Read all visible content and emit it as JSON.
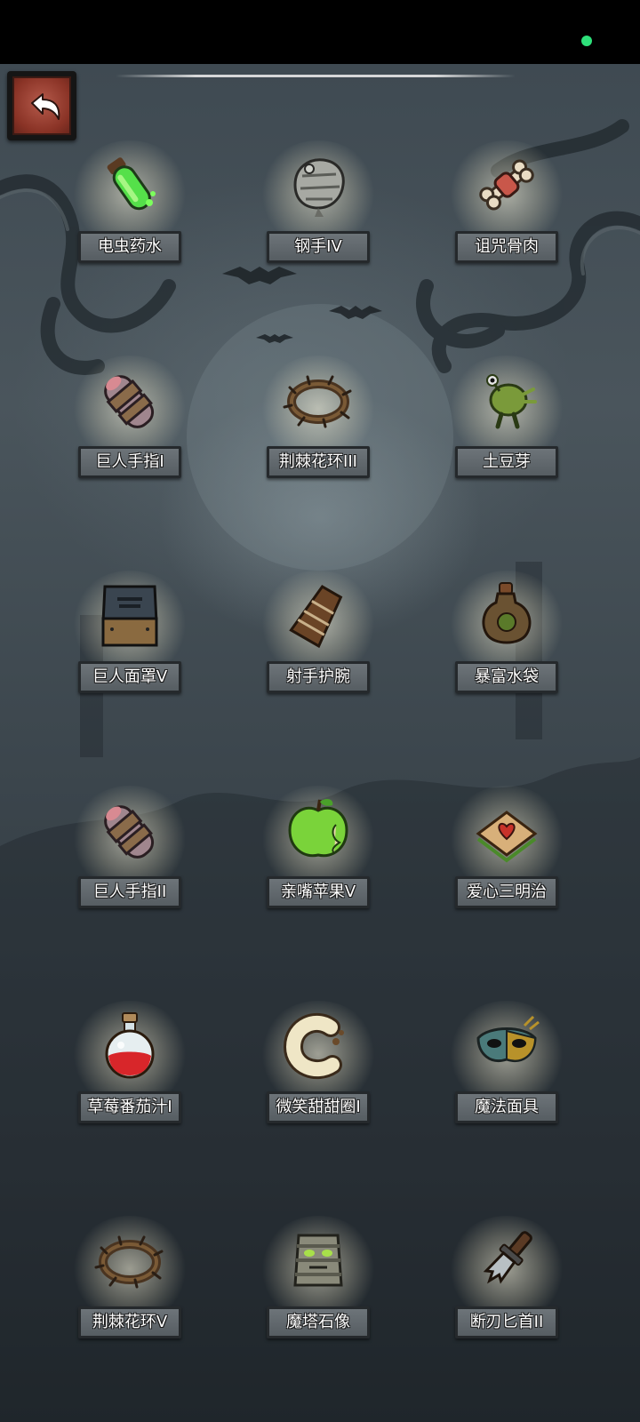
{
  "status_bar": {
    "indicator_color": "#2ee07a"
  },
  "back_button": {
    "icon": "back-arrow-icon"
  },
  "items": [
    {
      "label": "电虫药水",
      "icon": "green-potion-vial-icon"
    },
    {
      "label": "钢手IV",
      "icon": "steel-gauntlet-icon"
    },
    {
      "label": "诅咒骨肉",
      "icon": "cursed-bone-meat-icon"
    },
    {
      "label": "巨人手指I",
      "icon": "giant-finger-icon"
    },
    {
      "label": "荆棘花环III",
      "icon": "thorn-wreath-icon"
    },
    {
      "label": "土豆芽",
      "icon": "potato-sprout-icon"
    },
    {
      "label": "巨人面罩V",
      "icon": "giant-mask-icon"
    },
    {
      "label": "射手护腕",
      "icon": "archer-bracer-icon"
    },
    {
      "label": "暴富水袋",
      "icon": "water-flask-icon"
    },
    {
      "label": "巨人手指II",
      "icon": "giant-finger-icon"
    },
    {
      "label": "亲嘴苹果V",
      "icon": "bitten-green-apple-icon"
    },
    {
      "label": "爱心三明治",
      "icon": "heart-sandwich-icon"
    },
    {
      "label": "草莓番茄汁I",
      "icon": "red-juice-flask-icon"
    },
    {
      "label": "微笑甜甜圈I",
      "icon": "smile-donut-icon"
    },
    {
      "label": "魔法面具",
      "icon": "magic-mask-icon"
    },
    {
      "label": "荆棘花环V",
      "icon": "thorn-wreath-icon"
    },
    {
      "label": "魔塔石像",
      "icon": "tower-stone-statue-icon"
    },
    {
      "label": "断刃匕首II",
      "icon": "broken-dagger-icon"
    }
  ]
}
